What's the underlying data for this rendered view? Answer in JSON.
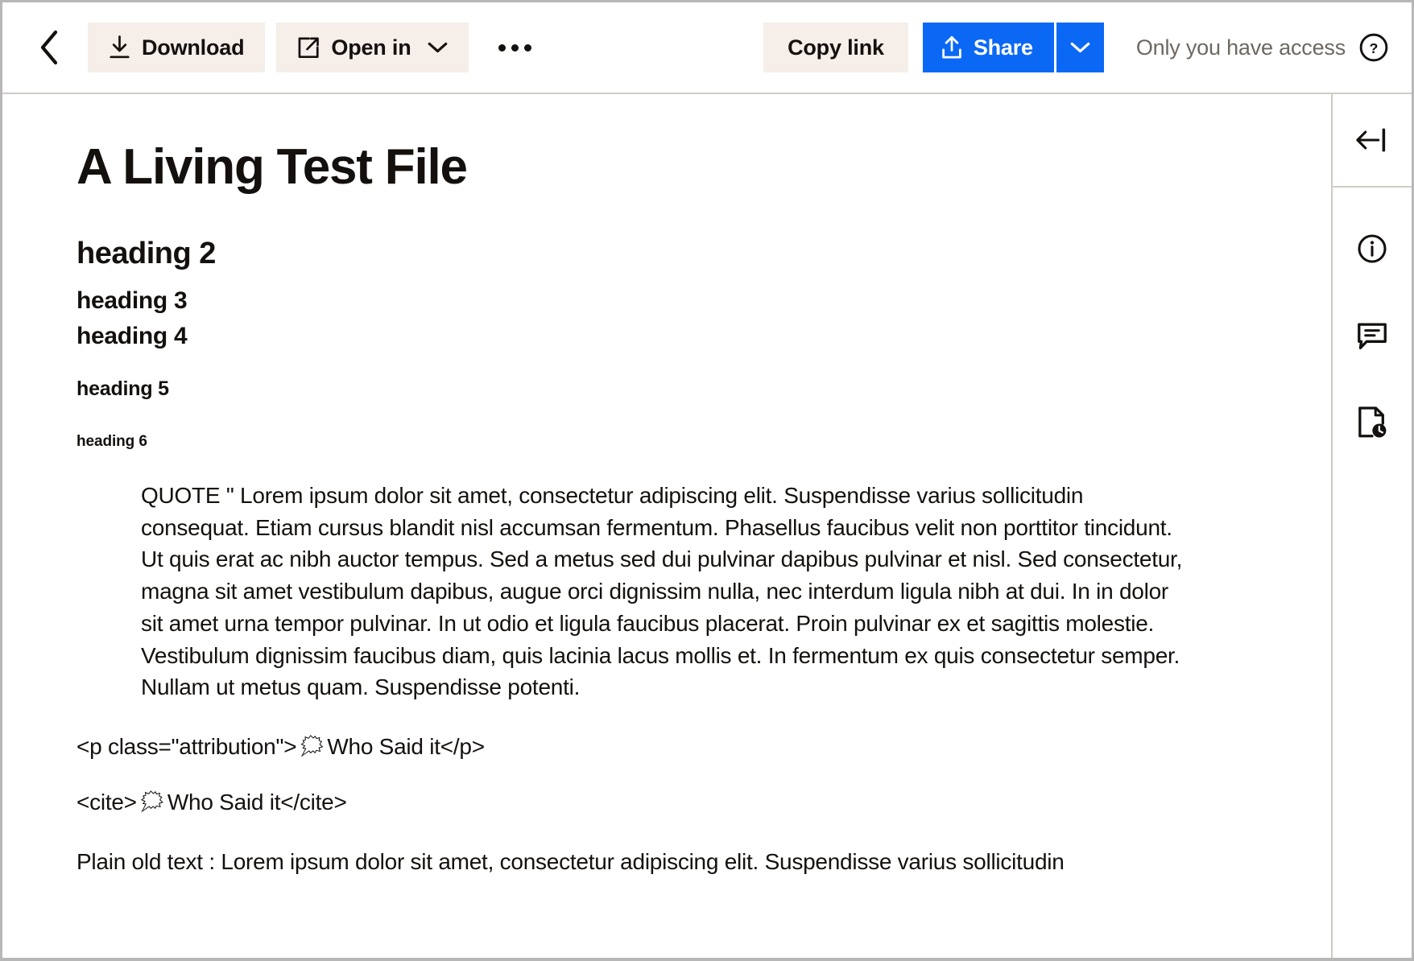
{
  "toolbar": {
    "back_icon": "chevron-left-icon",
    "download_label": "Download",
    "download_icon": "download-icon",
    "open_in_label": "Open in",
    "open_in_icon": "external-link-icon",
    "open_in_caret_icon": "chevron-down-icon",
    "more_label": "•••",
    "more_icon": "ellipsis-icon",
    "copy_link_label": "Copy link",
    "share_label": "Share",
    "share_icon": "share-upload-icon",
    "share_caret_icon": "chevron-down-icon",
    "access_note": "Only you have access",
    "help_icon": "question-circle-icon",
    "colors": {
      "cream_button": "#f5eee9",
      "share_blue": "#0b68f5",
      "text": "#14100e",
      "muted_text": "#6d6862",
      "border": "#cfccc6"
    }
  },
  "document": {
    "title": "A Living Test File",
    "heading2": "heading 2",
    "heading3": "heading 3",
    "heading4": "heading 4",
    "heading5": "heading 5",
    "heading6": "heading 6",
    "blockquote": "QUOTE \" Lorem ipsum dolor sit amet, consectetur adipiscing elit. Suspendisse varius sollicitudin consequat. Etiam cursus blandit nisl accumsan fermentum. Phasellus faucibus velit non porttitor tincidunt. Ut quis erat ac nibh auctor tempus. Sed a metus sed dui pulvinar dapibus pulvinar et nisl. Sed consectetur, magna sit amet vestibulum dapibus, augue orci dignissim nulla, nec interdum ligula nibh at dui. In in dolor sit amet urna tempor pulvinar. In ut odio et ligula faucibus placerat. Proin pulvinar ex et sagittis molestie. Vestibulum dignissim faucibus diam, quis lacinia lacus mollis et. In fermentum ex quis consectetur semper. Nullam ut metus quam. Suspendisse potenti.",
    "attribution_line": {
      "before": "<p class=\"attribution\">",
      "emoji": "🗯",
      "after": " Who Said it</p>"
    },
    "cite_line": {
      "before": "<cite>",
      "emoji": "🗯",
      "after": " Who Said it</cite>"
    },
    "plain_text": "Plain old text : Lorem ipsum dolor sit amet, consectetur adipiscing elit. Suspendisse varius sollicitudin"
  },
  "right_rail": {
    "collapse_icon": "collapse-panel-icon",
    "items": [
      {
        "icon": "info-circle-icon",
        "name": "file-information"
      },
      {
        "icon": "comment-icon",
        "name": "comments"
      },
      {
        "icon": "file-clock-icon",
        "name": "version-history"
      }
    ]
  }
}
